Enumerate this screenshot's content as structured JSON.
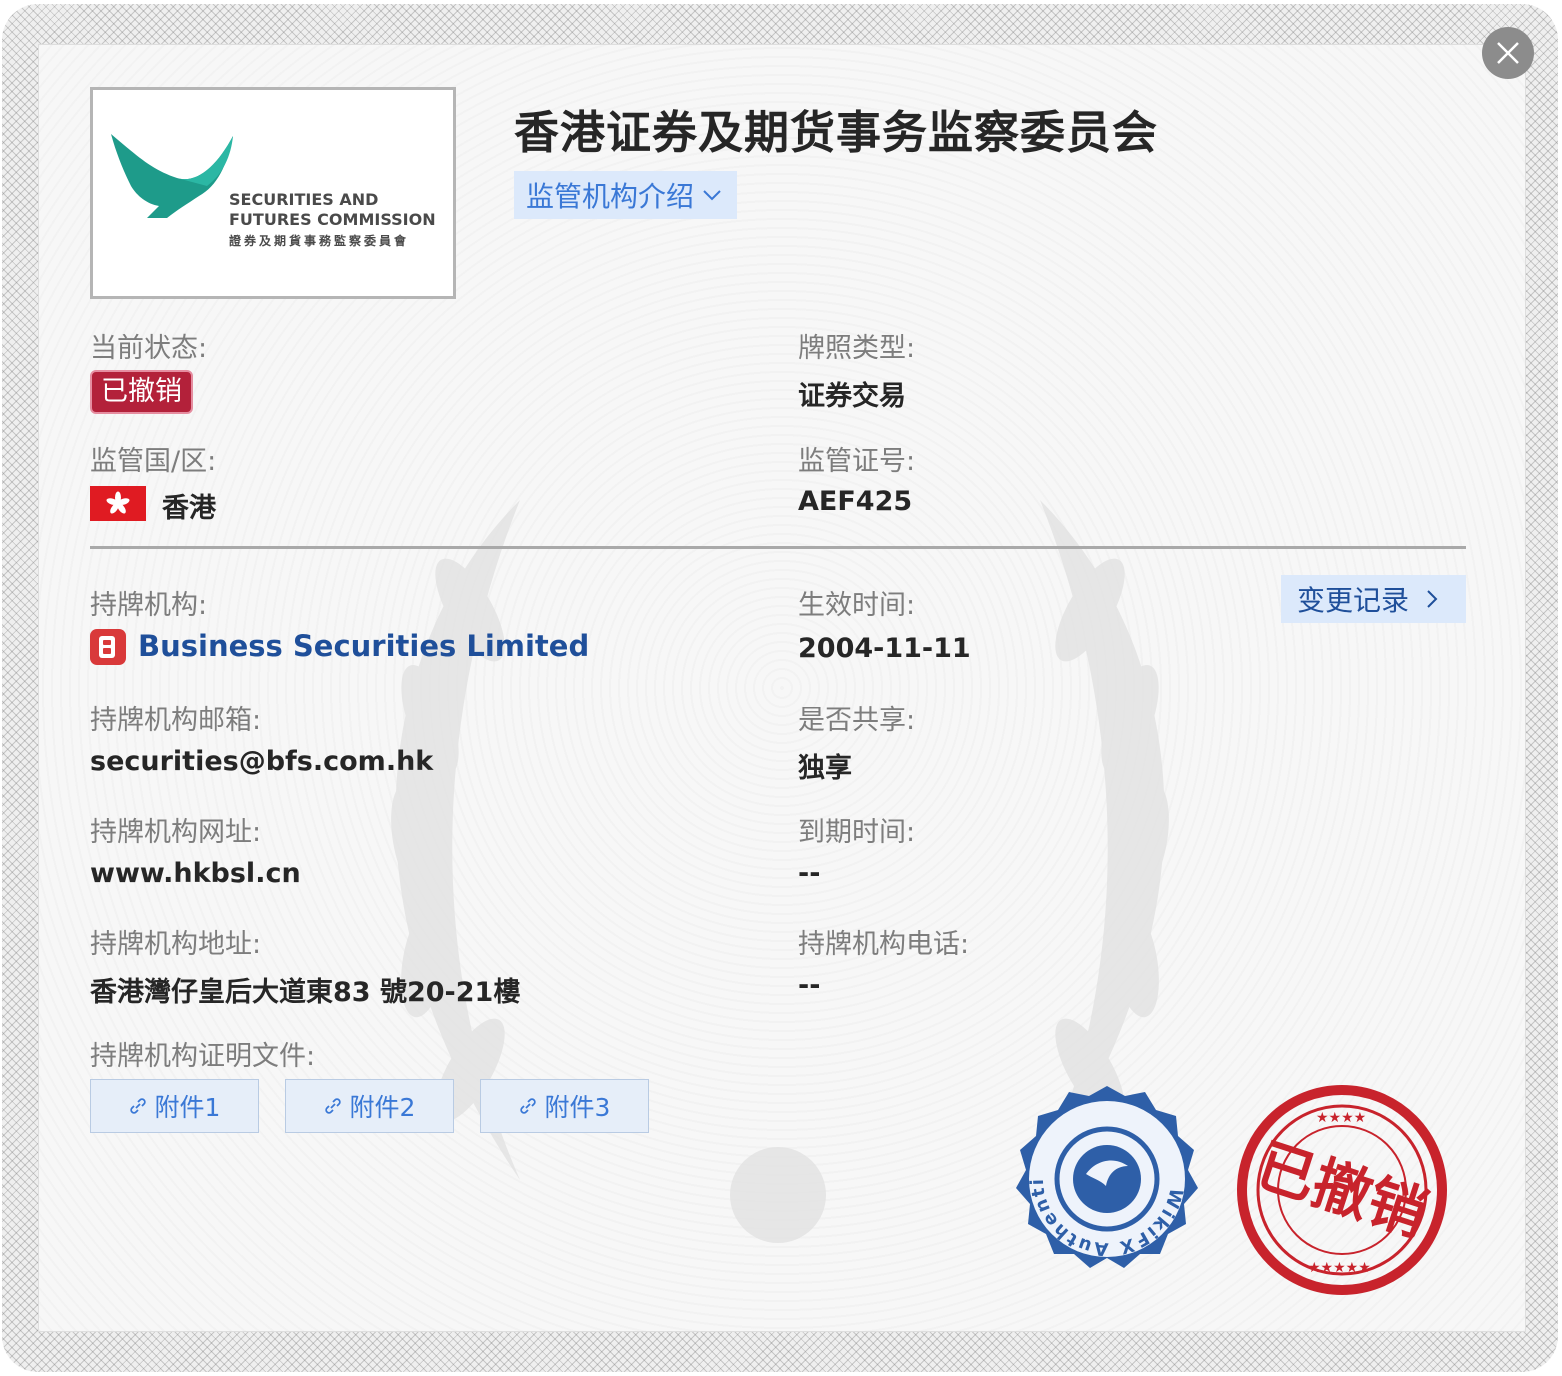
{
  "header": {
    "title": "香港证券及期货事务监察委员会",
    "intro_label": "监管机构介绍",
    "logo": {
      "line1": "SECURITIES AND",
      "line2": "FUTURES COMMISSION",
      "line3": "證券及期貨事務監察委員會"
    }
  },
  "fields": {
    "status_label": "当前状态:",
    "status_value": "已撤销",
    "license_type_label": "牌照类型:",
    "license_type_value": "证券交易",
    "region_label": "监管国/区:",
    "region_value": "香港",
    "license_no_label": "监管证号:",
    "license_no_value": "AEF425",
    "holder_label": "持牌机构:",
    "holder_value": "Business Securities Limited",
    "effective_label": "生效时间:",
    "effective_value": "2004-11-11",
    "change_log_label": "变更记录",
    "email_label": "持牌机构邮箱:",
    "email_value": "securities@bfs.com.hk",
    "shared_label": "是否共享:",
    "shared_value": "独享",
    "website_label": "持牌机构网址:",
    "website_value": "www.hkbsl.cn",
    "expiry_label": "到期时间:",
    "expiry_value": "--",
    "address_label": "持牌机构地址:",
    "address_value": "香港灣仔皇后大道東83 號20-21樓",
    "phone_label": "持牌机构电话:",
    "phone_value": "--",
    "docs_label": "持牌机构证明文件:"
  },
  "attachments": [
    "附件1",
    "附件2",
    "附件3"
  ],
  "stamps": {
    "auth_text": "WikiFX Authentication Center",
    "revoked_text": "已撤销"
  },
  "colors": {
    "accent_blue": "#3a78d6",
    "revoked_red": "#b3213a",
    "stamp_blue": "#2e5fa8",
    "stamp_red": "#c8232c"
  },
  "icons": [
    "close-icon",
    "chevron-down-icon",
    "chevron-right-icon",
    "hk-flag-icon",
    "link-icon",
    "eagle-logo-icon"
  ]
}
